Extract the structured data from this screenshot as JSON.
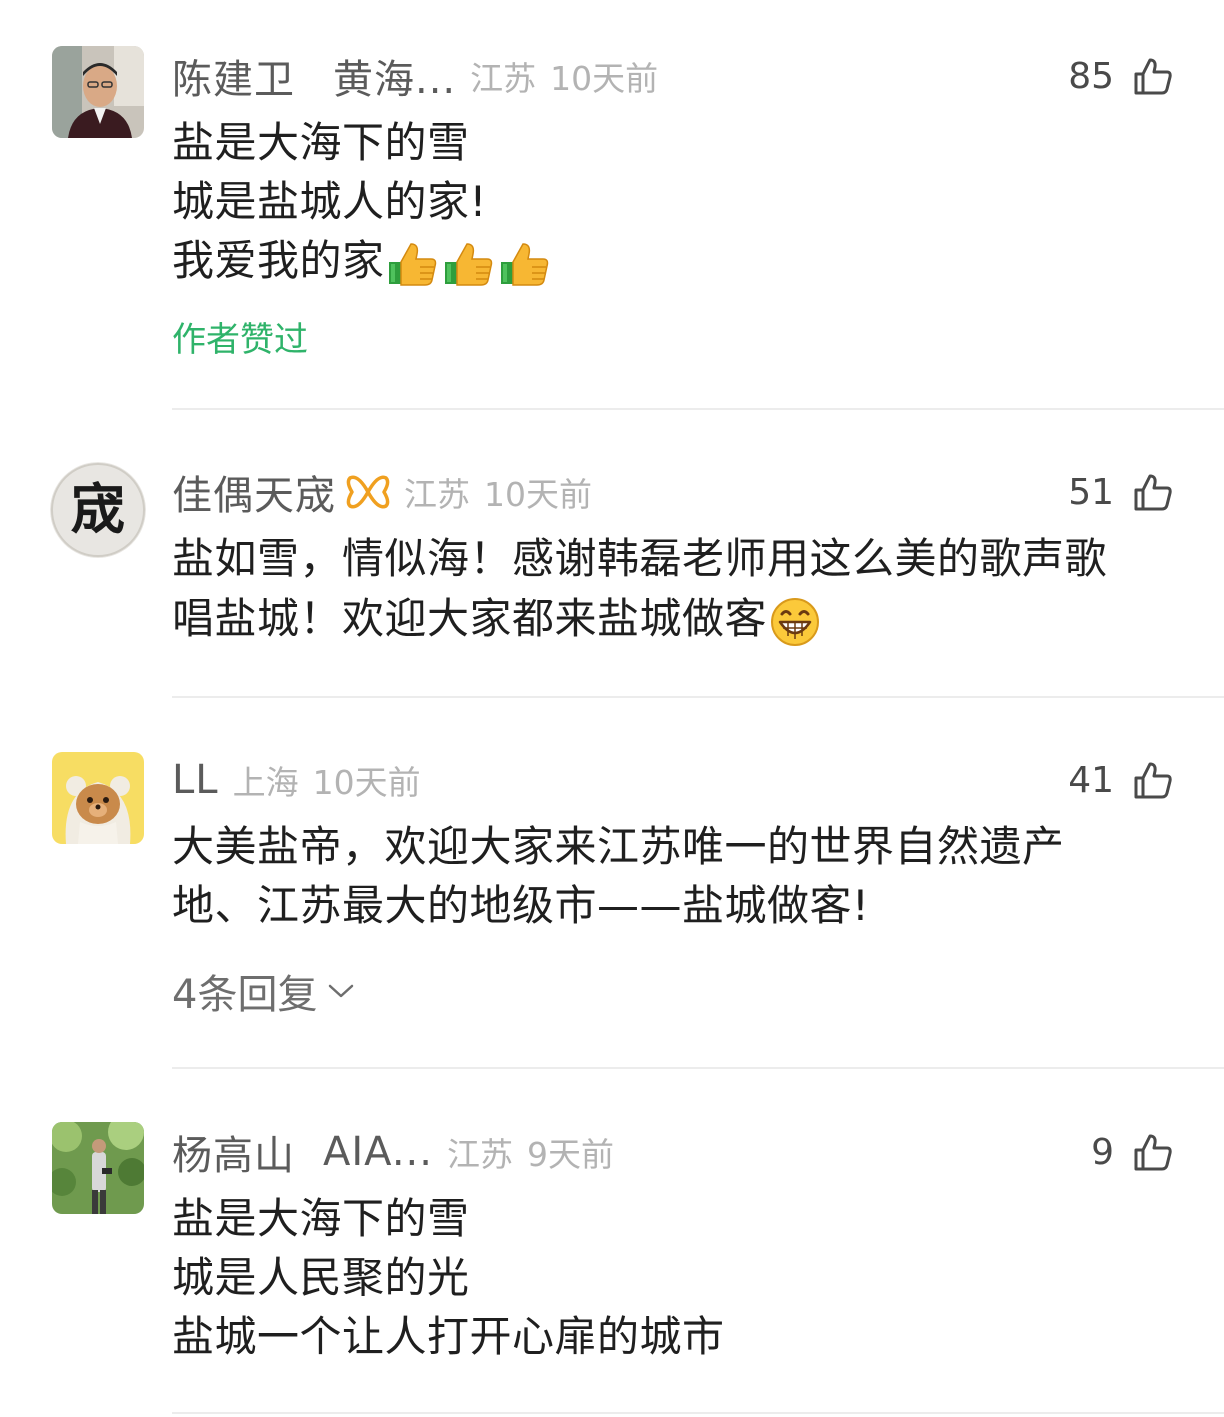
{
  "comments": [
    {
      "author": "陈建卫",
      "author_extra": "黄海...",
      "location": "江苏",
      "time": "10天前",
      "likes": "85",
      "lines": [
        "盐是大海下的雪",
        "城是盐城人的家!",
        "我爱我的家"
      ],
      "author_liked": "作者赞过"
    },
    {
      "author": "佳偶天宬",
      "location": "江苏",
      "time": "10天前",
      "likes": "51",
      "avatar_char": "宬",
      "lines": [
        "盐如雪，情似海！感谢韩磊老师用这么美的歌声歌",
        "唱盐城！欢迎大家都来盐城做客"
      ]
    },
    {
      "author": "LL",
      "location": "上海",
      "time": "10天前",
      "likes": "41",
      "lines": [
        "大美盐帝，欢迎大家来江苏唯一的世界自然遗产",
        "地、江苏最大的地级市——盐城做客!"
      ],
      "replies": "4条回复"
    },
    {
      "author": "杨高山",
      "author_extra": "AIA...",
      "location": "江苏",
      "time": "9天前",
      "likes": "9",
      "lines": [
        "盐是大海下的雪",
        "城是人民聚的光",
        "盐城一个让人打开心扉的城市"
      ]
    }
  ],
  "colors": {
    "author_liked": "#2fb36a",
    "meta": "#b3b3b3",
    "badge": "#f0a020"
  },
  "icons": [
    "thumbs-up-icon",
    "thumbs-up-emoji",
    "grin-emoji",
    "chevron-down-icon",
    "butterfly-badge-icon"
  ]
}
